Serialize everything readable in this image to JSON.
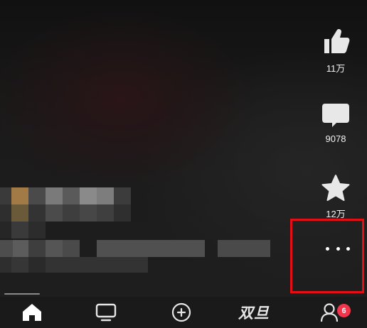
{
  "video": {
    "description_blur": true
  },
  "actions": {
    "like_count": "11万",
    "comment_count": "9078",
    "favorite_count": "12万"
  },
  "nav": {
    "double_label": "双旦",
    "badge_count": "6"
  },
  "colors": {
    "highlight": "#e30f14",
    "badge": "#f2354a",
    "icon": "#e8e8e8",
    "nav_bg": "#1a1a1a"
  },
  "icons": {
    "like": "thumbs-up-icon",
    "comment": "comment-bubble-icon",
    "favorite": "star-icon",
    "more": "more-dots-icon",
    "home": "home-icon",
    "tv": "tv-icon",
    "add": "add-circle-icon",
    "me": "user-icon"
  }
}
